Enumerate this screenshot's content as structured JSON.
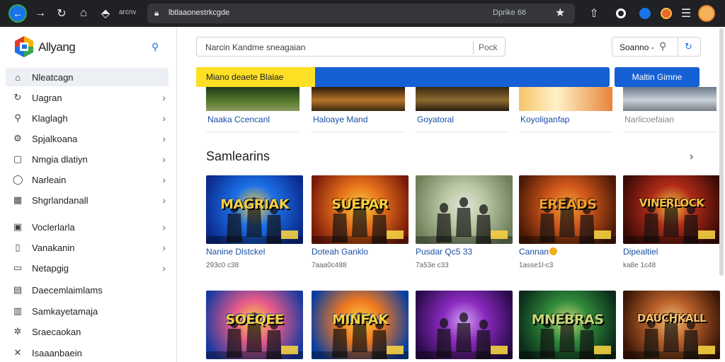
{
  "browser": {
    "tab_name": "arcnv",
    "url": "lbtlaaonestrkcgde",
    "omnibox_right": "Dprike 66",
    "icons": [
      "back-icon",
      "forward-icon",
      "reload-icon",
      "home-icon",
      "extension-icon",
      "lock-icon",
      "star-icon",
      "share-icon",
      "profile-dot-icon",
      "blue-extension-icon",
      "orange-extension-icon",
      "menu-icon"
    ]
  },
  "sidebar": {
    "brand": "Allyang",
    "items": [
      {
        "label": "Nleatcagn",
        "icon": "home-icon",
        "active": true
      },
      {
        "label": "Uagran",
        "icon": "refresh-icon",
        "chevron": true
      },
      {
        "label": "Klaglagh",
        "icon": "search-icon",
        "chevron": true
      },
      {
        "label": "Spjalkoana",
        "icon": "settings-icon",
        "chevron": true
      },
      {
        "label": "Nmgia dlatiyn",
        "icon": "square-icon",
        "chevron": true
      },
      {
        "label": "Narleain",
        "icon": "circle-icon",
        "chevron": true
      },
      {
        "label": "Shgrlandanall",
        "icon": "grid-icon",
        "chevron": true
      },
      {
        "label": "Voclerlarla",
        "icon": "box-icon",
        "chevron": true
      },
      {
        "label": "Vanakanin",
        "icon": "page-icon",
        "chevron": true
      },
      {
        "label": "Netapgig",
        "icon": "frame-icon",
        "chevron": true
      },
      {
        "label": "Daecemlaimlams",
        "icon": "doc-icon"
      },
      {
        "label": "Samkayetamaja",
        "icon": "tab-icon"
      },
      {
        "label": "Sraecaokan",
        "icon": "gear-icon"
      },
      {
        "label": "Isaaanbaein",
        "icon": "tools-icon"
      }
    ]
  },
  "search": {
    "placeholder": "Narcin Kandme sneagaian",
    "button": "Pock"
  },
  "sort": {
    "label": "Soanno -"
  },
  "banner": {
    "text": "Miano deaete Blaiae",
    "button": "Maltin Gimne"
  },
  "row1": [
    {
      "title": "Naaka Ccencanl",
      "muted": false
    },
    {
      "title": "Haloaye Mand",
      "muted": false
    },
    {
      "title": "Goyatoral",
      "muted": false
    },
    {
      "title": "Koyoliganfap",
      "muted": false
    },
    {
      "title": "Narlicoefaian",
      "muted": true
    }
  ],
  "section": {
    "title": "Samlearins"
  },
  "games": [
    {
      "title": "Nanine Dlstckel",
      "meta": "293c0 c38",
      "art": "MAGRIAK",
      "palette": [
        "#0b2a8c",
        "#1b6fe8",
        "#f5d040"
      ]
    },
    {
      "title": "Doteah Ganklo",
      "meta": "7aaa0c488",
      "art": "SUEPAR",
      "palette": [
        "#7a1a0a",
        "#e8721b",
        "#f5d040"
      ]
    },
    {
      "title": "Pusdar Qc5 33",
      "meta": "7a53e c33",
      "art": "",
      "palette": [
        "#6f7f5a",
        "#b9c7a3",
        "#e0e6d8"
      ]
    },
    {
      "title": "Cannan",
      "meta": "1asse1l-c3",
      "art": "EREADS",
      "palette": [
        "#4a1a06",
        "#d1561b",
        "#f0a030"
      ]
    },
    {
      "title": "Dipealtiel",
      "meta": "ka8e 1c48",
      "art": "VINERLOCK",
      "palette": [
        "#3a0b06",
        "#b02a17",
        "#f2c045"
      ]
    },
    {
      "title": "",
      "meta": "",
      "art": "SOEQEE",
      "palette": [
        "#1a3aa0",
        "#e85a8a",
        "#f5d040"
      ]
    },
    {
      "title": "",
      "meta": "",
      "art": "MINFAK",
      "palette": [
        "#0b3fa0",
        "#f07820",
        "#f5d040"
      ]
    },
    {
      "title": "",
      "meta": "",
      "art": "",
      "palette": [
        "#2a0b4a",
        "#8a2ac0",
        "#d0a0f0"
      ]
    },
    {
      "title": "",
      "meta": "",
      "art": "MNEBRAS",
      "palette": [
        "#0a2a1a",
        "#2f8a3a",
        "#c8d878"
      ]
    },
    {
      "title": "",
      "meta": "",
      "art": "DAUCHKALL",
      "palette": [
        "#3a1606",
        "#b8602a",
        "#f0c070"
      ]
    }
  ]
}
